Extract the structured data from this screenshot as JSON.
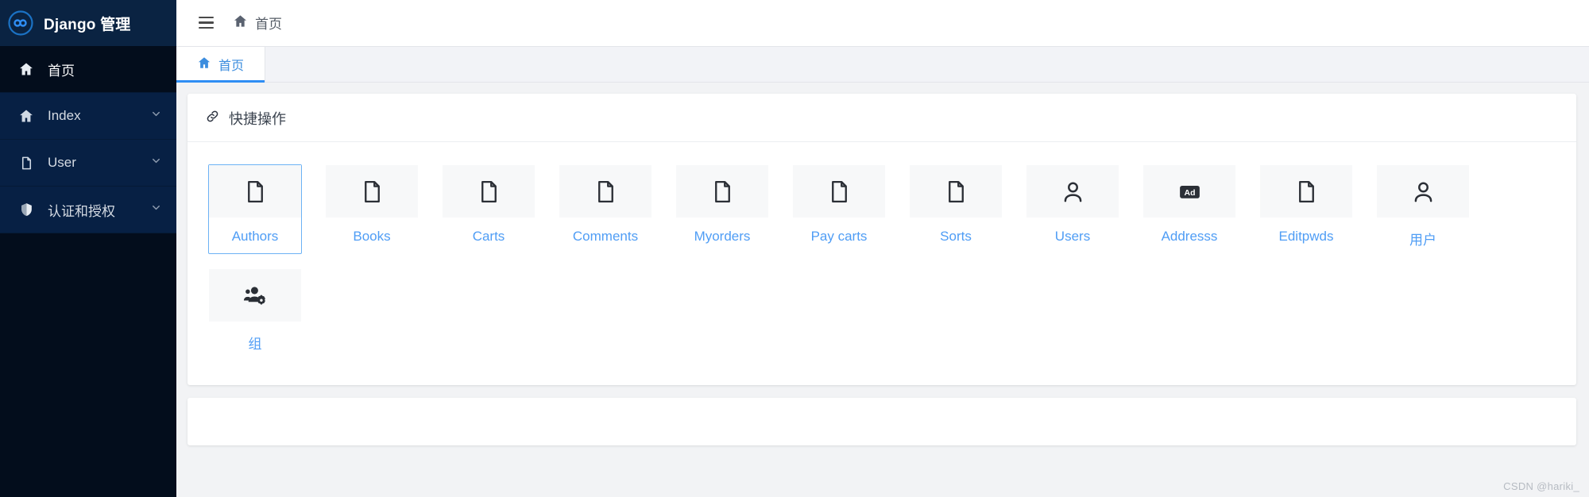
{
  "brand": {
    "title": "Django 管理",
    "logo_icon": "infinity-circle-icon"
  },
  "sidebar": {
    "items": [
      {
        "label": "首页",
        "icon": "home-icon",
        "active": true,
        "caret": false
      },
      {
        "label": "Index",
        "icon": "home-icon",
        "active": false,
        "caret": true
      },
      {
        "label": "User",
        "icon": "file-icon",
        "active": false,
        "caret": true
      },
      {
        "label": "认证和授权",
        "icon": "shield-icon",
        "active": false,
        "caret": true
      }
    ]
  },
  "topbar": {
    "menu_icon": "hamburger-icon",
    "breadcrumb": {
      "label": "首页",
      "icon": "home-icon"
    }
  },
  "tabs": [
    {
      "label": "首页",
      "icon": "home-icon",
      "active": true
    }
  ],
  "quick_actions": {
    "title": "快捷操作",
    "icon": "link-icon",
    "tiles": [
      {
        "label": "Authors",
        "icon": "file-icon",
        "selected": true
      },
      {
        "label": "Books",
        "icon": "file-icon",
        "selected": false
      },
      {
        "label": "Carts",
        "icon": "file-icon",
        "selected": false
      },
      {
        "label": "Comments",
        "icon": "file-icon",
        "selected": false
      },
      {
        "label": "Myorders",
        "icon": "file-icon",
        "selected": false
      },
      {
        "label": "Pay carts",
        "icon": "file-icon",
        "selected": false
      },
      {
        "label": "Sorts",
        "icon": "file-icon",
        "selected": false
      },
      {
        "label": "Users",
        "icon": "user-icon",
        "selected": false
      },
      {
        "label": "Addresss",
        "icon": "ad-badge-icon",
        "selected": false
      },
      {
        "label": "Editpwds",
        "icon": "file-icon",
        "selected": false
      },
      {
        "label": "用户",
        "icon": "user-icon",
        "selected": false
      },
      {
        "label": "组",
        "icon": "users-cog-icon",
        "selected": false
      }
    ]
  },
  "watermark": "CSDN @hariki_",
  "colors": {
    "sidebar_bg": "#030d1c",
    "sidebar_item_bg": "#072044",
    "brand_bg": "#0a2342",
    "accent_blue": "#2f8ef4",
    "link_blue": "#4f9df5",
    "page_bg": "#f2f3f5"
  }
}
